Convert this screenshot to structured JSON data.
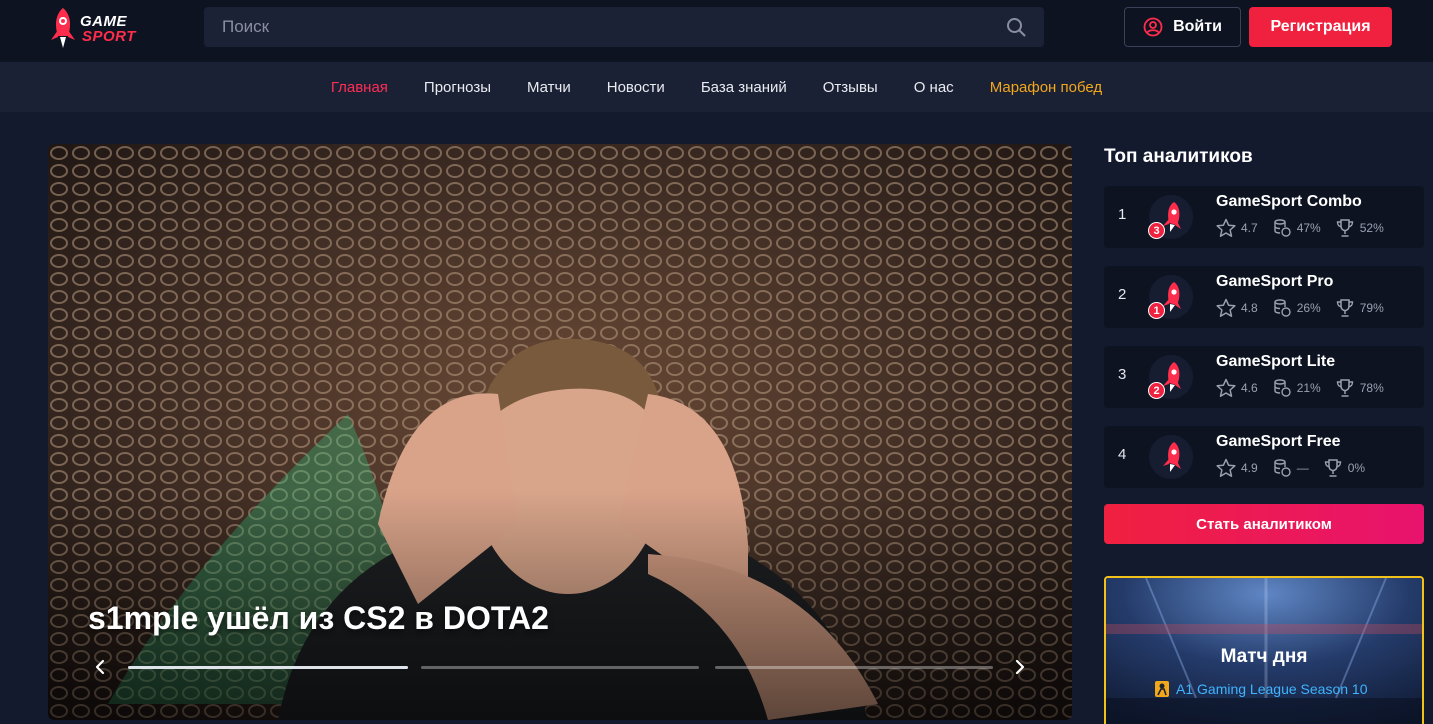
{
  "header": {
    "logo_line1": "GAME",
    "logo_line2": "SPORT",
    "search_placeholder": "Поиск",
    "login_label": "Войти",
    "register_label": "Регистрация"
  },
  "nav": {
    "items": [
      {
        "label": "Главная",
        "state": "active"
      },
      {
        "label": "Прогнозы"
      },
      {
        "label": "Матчи"
      },
      {
        "label": "Новости"
      },
      {
        "label": "База знаний"
      },
      {
        "label": "Отзывы"
      },
      {
        "label": "О нас"
      },
      {
        "label": "Марафон побед",
        "state": "highlight"
      }
    ]
  },
  "hero": {
    "title": "s1mple ушёл из CS2 в DOTA2",
    "slides_progress": [
      1.0,
      0.0,
      0.0
    ]
  },
  "sidebar": {
    "title": "Топ аналитиков",
    "analysts": [
      {
        "rank": "1",
        "name": "GameSport Combo",
        "badge": "3",
        "rating": "4.7",
        "bank": "47%",
        "wins": "52%"
      },
      {
        "rank": "2",
        "name": "GameSport Pro",
        "badge": "1",
        "rating": "4.8",
        "bank": "26%",
        "wins": "79%"
      },
      {
        "rank": "3",
        "name": "GameSport Lite",
        "badge": "2",
        "rating": "4.6",
        "bank": "21%",
        "wins": "78%"
      },
      {
        "rank": "4",
        "name": "GameSport Free",
        "badge": "",
        "rating": "4.9",
        "bank": "—",
        "wins": "0%"
      }
    ],
    "become_label": "Стать аналитиком",
    "match_day": {
      "title": "Матч дня",
      "league": "A1 Gaming League Season 10"
    }
  },
  "colors": {
    "accent": "#f0203f",
    "nav_active": "#ff2d55",
    "nav_highlight": "#f2a71b",
    "header_bg": "#0e1322",
    "page_bg": "#141a2e"
  }
}
